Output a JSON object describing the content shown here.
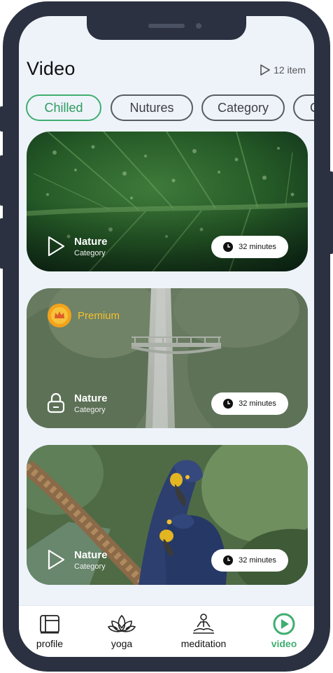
{
  "header": {
    "title": "Video",
    "item_count": "12 item"
  },
  "chips": [
    {
      "label": "Chilled",
      "active": true
    },
    {
      "label": "Nutures",
      "active": false
    },
    {
      "label": "Category",
      "active": false
    },
    {
      "label": "C",
      "active": false
    }
  ],
  "cards": [
    {
      "title": "Nature",
      "subtitle": "Category",
      "duration": "32 minutes",
      "locked": false,
      "premium": false,
      "scene": "leaf"
    },
    {
      "title": "Nature",
      "subtitle": "Category",
      "duration": "32 minutes",
      "locked": true,
      "premium": true,
      "premium_label": "Premium",
      "scene": "waterfall"
    },
    {
      "title": "Nature",
      "subtitle": "Category",
      "duration": "32 minutes",
      "locked": false,
      "premium": false,
      "scene": "parrots"
    }
  ],
  "tabs": [
    {
      "label": "profile",
      "icon": "profile-icon",
      "active": false
    },
    {
      "label": "yoga",
      "icon": "lotus-icon",
      "active": false
    },
    {
      "label": "meditation",
      "icon": "meditation-icon",
      "active": false
    },
    {
      "label": "video",
      "icon": "play-circle-icon",
      "active": true
    }
  ],
  "colors": {
    "accent": "#3fae6f",
    "premium": "#f4c02c",
    "background": "#eef3fa"
  }
}
